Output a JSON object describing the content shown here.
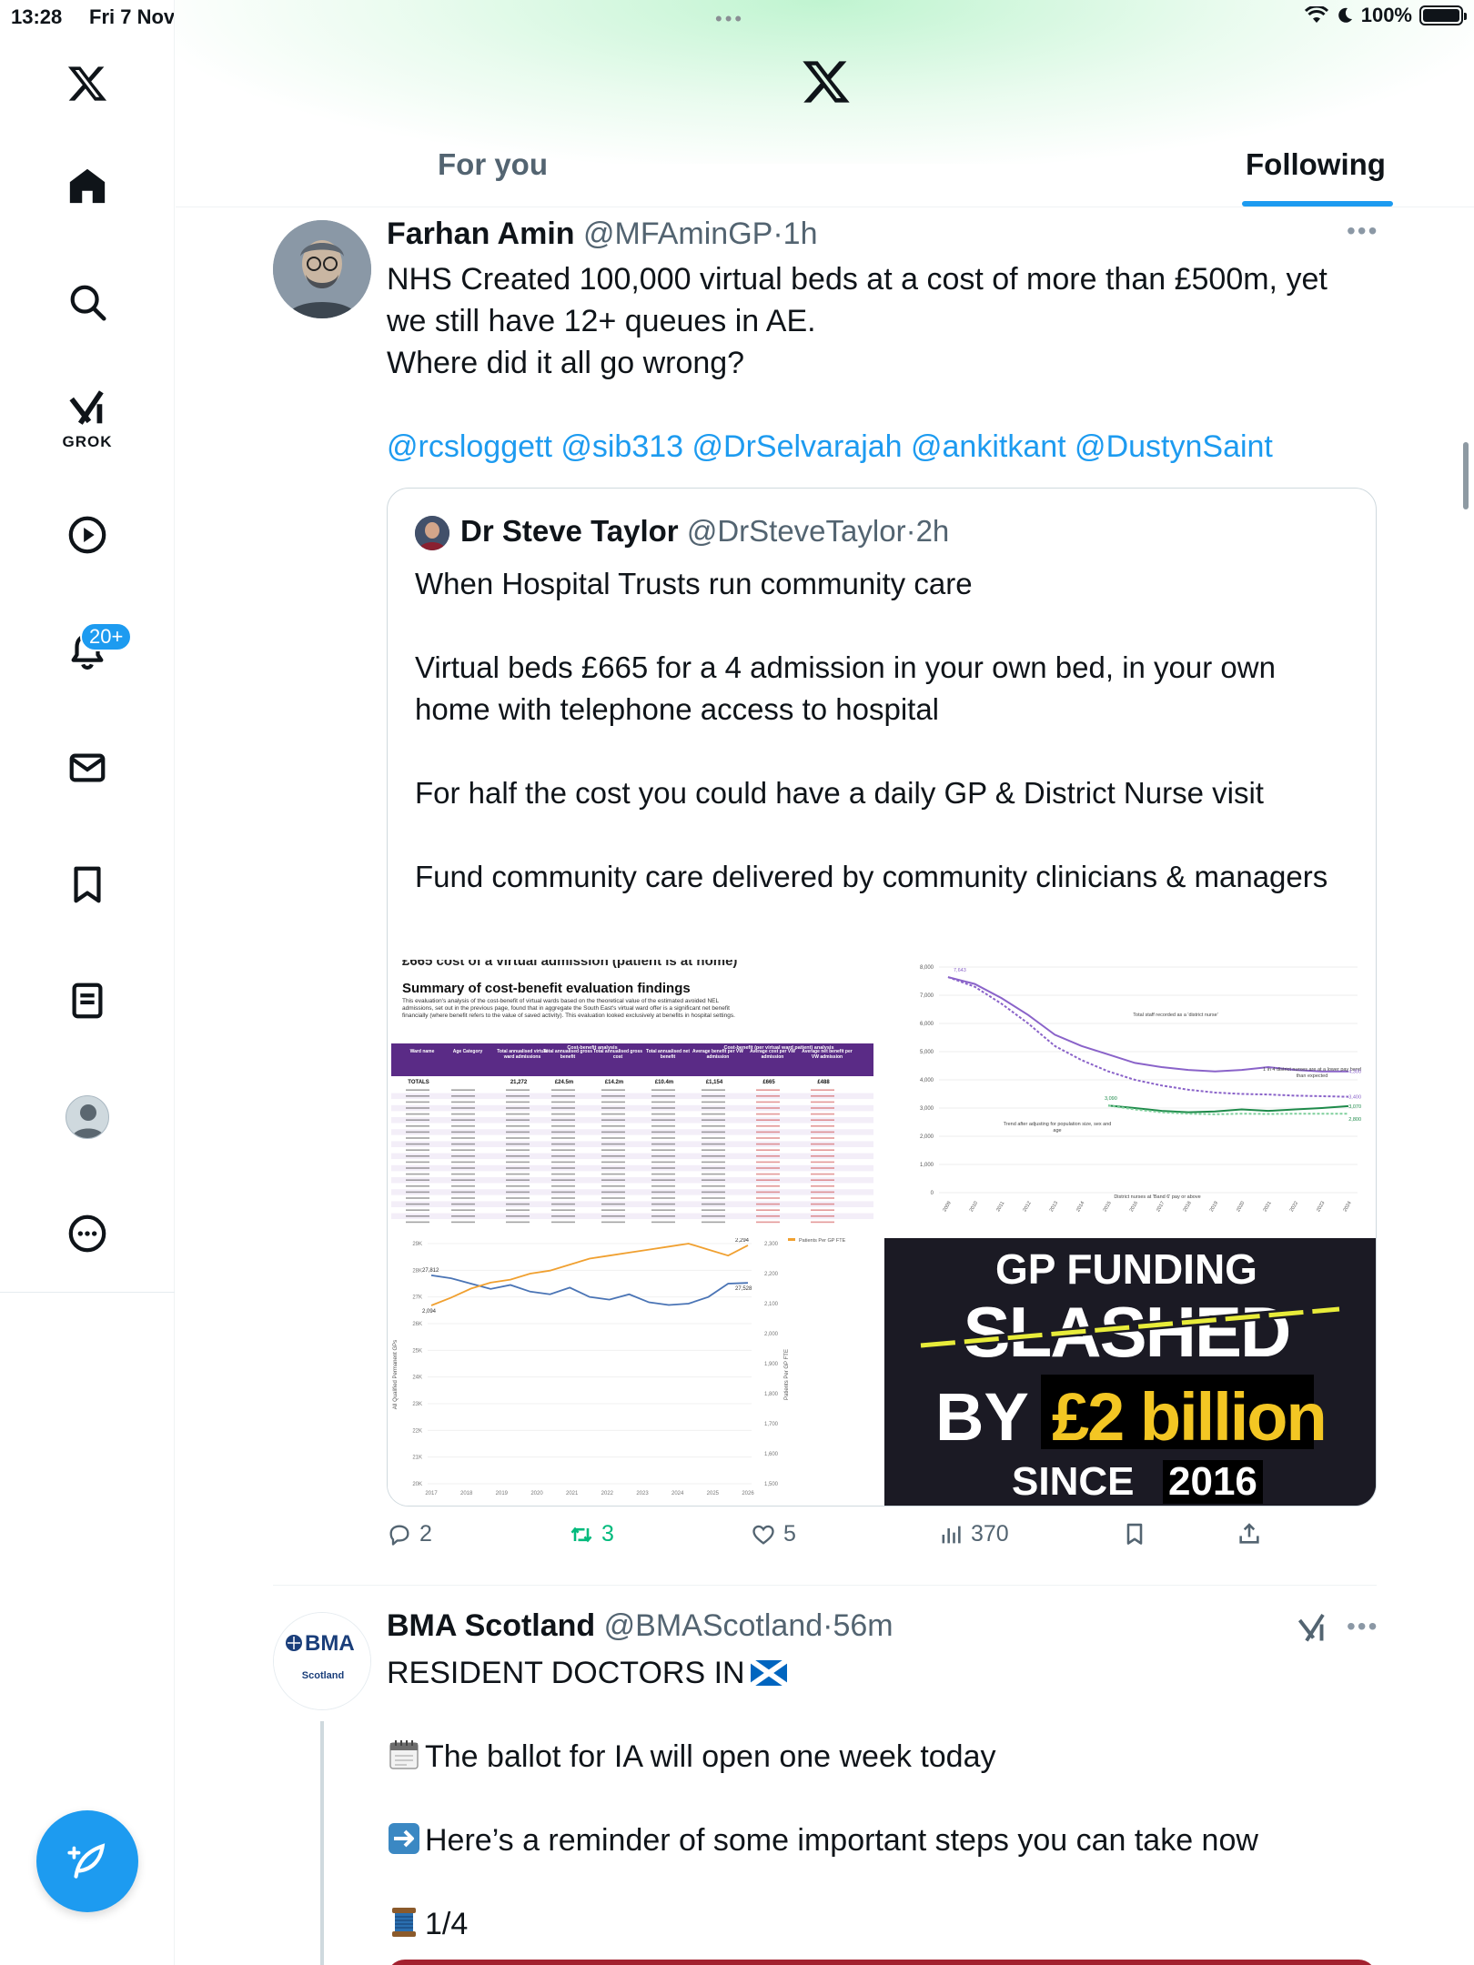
{
  "status_bar": {
    "time": "13:28",
    "date": "Fri 7 Nov",
    "battery": "100%"
  },
  "sidebar": {
    "grok_label": "GROK",
    "notifications_badge": "20+",
    "items": [
      "home-icon",
      "search-icon",
      "grok-icon",
      "video-icon",
      "notifications-icon",
      "messages-icon",
      "bookmarks-icon",
      "lists-icon",
      "profile-icon",
      "more-icon"
    ]
  },
  "header": {
    "tabs": [
      {
        "label": "For you",
        "active": false
      },
      {
        "label": "Following",
        "active": true
      }
    ]
  },
  "colors": {
    "accent": "#1d9bf0",
    "text": "#0f1419",
    "secondary": "#536471",
    "retweet": "#00ba7c"
  },
  "tweets": [
    {
      "name": "Farhan Amin",
      "handle": "@MFAminGP",
      "time": "1h",
      "lines": [
        "NHS Created 100,000 virtual beds at a cost of more than £500m, yet",
        "we still have 12+ queues in AE.",
        "Where did it all go wrong?"
      ],
      "mentions": "@rcsloggett @sib313 @DrSelvarajah @ankitkant @DustynSaint",
      "quote": {
        "name": "Dr Steve Taylor",
        "handle": "@DrSteveTaylor",
        "time": "2h",
        "paragraphs": [
          "When Hospital Trusts run community care",
          "Virtual beds £665 for a 4 admission in your own bed, in your own home with telephone access to hospital",
          "For half the cost you could have a daily GP & District Nurse visit",
          "Fund community care delivered by community clinicians & managers"
        ],
        "media": {
          "table_title_cut": "£665 cost of a virtual admission (patient is at home)",
          "table_heading": "Summary of cost-benefit evaluation findings",
          "table_intro": "This evaluation's analysis of the cost-benefit of virtual wards based on the theoretical value of the estimated avoided NEL admissions, set out in the previous page, found that in aggregate the South East's virtual ward offer is a significant net benefit financially (where benefit refers to the value of saved activity). This evaluation looked exclusively at benefits in hospital settings.",
          "table_headers": [
            "Ward name",
            "Age Category",
            "Total annualised virtual ward admissions",
            "Total annualised gross benefit",
            "Total annualised gross cost",
            "Total annualised net benefit",
            "Average benefit per VW admission",
            "Average cost per VW admission",
            "Average net benefit per VW admission"
          ],
          "table_group_headers": [
            "Cost-benefit analysis",
            "Cost-benefit (per virtual ward patient) analysis"
          ],
          "table_totals": [
            "TOTALS",
            "",
            "21,272",
            "£24.5m",
            "£14.2m",
            "£10.4m",
            "£1,154",
            "£665",
            "£488"
          ],
          "line_chart_y_ticks": [
            "8,000",
            "7,000",
            "6,000",
            "5,000",
            "4,000",
            "3,000",
            "2,000",
            "1,000",
            "0"
          ],
          "line_chart_x_ticks": [
            "2009",
            "2010",
            "2011",
            "2012",
            "2013",
            "2014",
            "2015",
            "2016",
            "2017",
            "2018",
            "2019",
            "2020",
            "2021",
            "2022",
            "2023",
            "2024"
          ],
          "line_chart_annotations": [
            "Total staff recorded as a 'district nurse'",
            "Trend after adjusting for population size, sex and age",
            "District nurses at 'Band 6' pay or above",
            "1 in 4 district nurses are at a lower pay band than expected"
          ],
          "line_chart_labels": [
            "7,643",
            "4,300",
            "3,400",
            "3,070",
            "2,800",
            "3,090"
          ],
          "gp_chart_left_ticks": [
            "29K",
            "28K",
            "27K",
            "26K",
            "25K",
            "24K",
            "23K",
            "22K",
            "21K",
            "20K"
          ],
          "gp_chart_right_ticks": [
            "2,300",
            "2,200",
            "2,100",
            "2,000",
            "1,900",
            "1,800",
            "1,700",
            "1,600",
            "1,500"
          ],
          "gp_chart_x_ticks": [
            "2017",
            "2018",
            "2019",
            "2020",
            "2021",
            "2022",
            "2023",
            "2024",
            "2025",
            "2026"
          ],
          "gp_chart_left_label": "All Qualified Permanent GPs",
          "gp_chart_right_label": "Patients Per GP FTE",
          "gp_chart_legend": "Patients Per GP FTE",
          "gp_chart_values": [
            "27,812",
            "2,094",
            "2,294",
            "27,528"
          ],
          "funding_lines": [
            "GP FUNDING",
            "SLASHED",
            "BY",
            "£2 billion",
            "SINCE",
            "2016"
          ]
        }
      },
      "stats": {
        "replies": "2",
        "reposts": "3",
        "likes": "5",
        "views": "370"
      }
    },
    {
      "name": "BMA Scotland",
      "handle": "@BMAScotland",
      "time": "56m",
      "avatar_text": "BMA",
      "avatar_sub": "Scotland",
      "title": "RESIDENT DOCTORS IN",
      "lines": [
        "The ballot for IA will open one week today",
        "Here’s a reminder of some important steps you can take now",
        "1/4"
      ]
    }
  ]
}
